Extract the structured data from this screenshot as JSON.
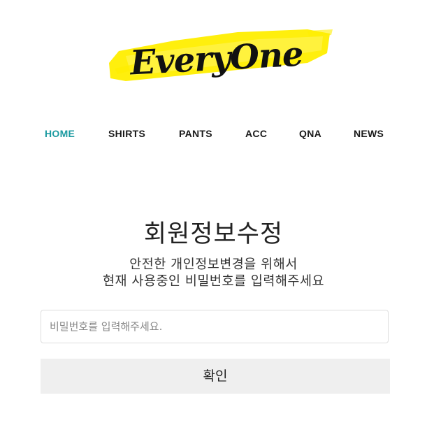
{
  "brand": {
    "logo_text": "EveryOne",
    "highlight_color": "#ffee00",
    "ink_color": "#111111"
  },
  "nav": {
    "active_color": "#1b9aa0",
    "items": [
      {
        "label": "HOME",
        "active": true
      },
      {
        "label": "SHIRTS",
        "active": false
      },
      {
        "label": "PANTS",
        "active": false
      },
      {
        "label": "ACC",
        "active": false
      },
      {
        "label": "QNA",
        "active": false
      },
      {
        "label": "NEWS",
        "active": false
      }
    ]
  },
  "main": {
    "title": "회원정보수정",
    "description_line1": "안전한 개인정보변경을 위해서",
    "description_line2": "현재 사용중인 비밀번호를 입력해주세요",
    "password_input": {
      "value": "",
      "placeholder": "비밀번호를 입력해주세요."
    },
    "confirm_label": "확인"
  }
}
